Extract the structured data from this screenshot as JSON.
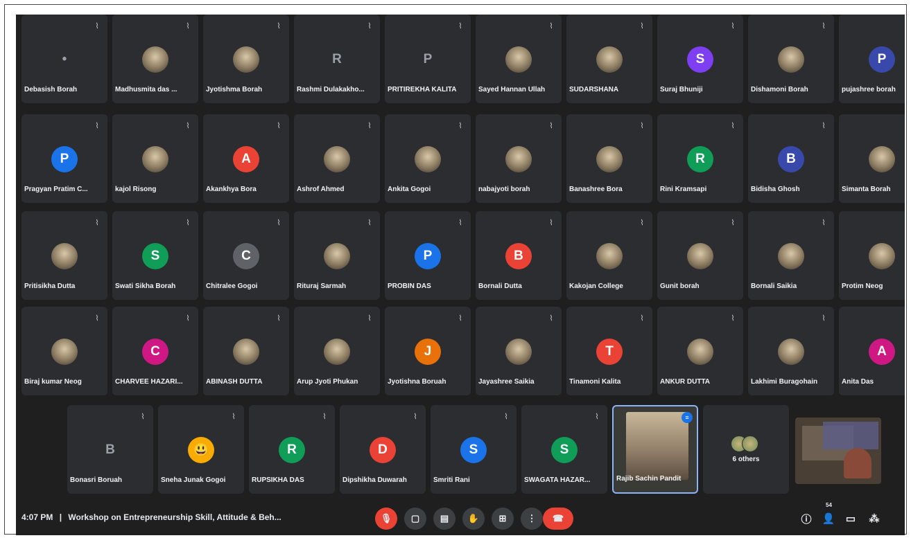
{
  "colors": {
    "blue": "#1a73e8",
    "teal": "#0f9d58",
    "gray": "#5f6368",
    "red": "#ea4335",
    "orange": "#e8710a",
    "pink": "#d01884",
    "dark": "#3c4043"
  },
  "rows": [
    [
      {
        "name": "Debasish Borah",
        "type": "plain",
        "letter": "•"
      },
      {
        "name": "Madhusmita das ...",
        "type": "photo"
      },
      {
        "name": "Jyotishma Borah",
        "type": "photo"
      },
      {
        "name": "Rashmi Dulakakho...",
        "type": "plain",
        "letter": "R"
      },
      {
        "name": "PRITIREKHA KALITA",
        "type": "plain",
        "letter": "P"
      },
      {
        "name": "Sayed Hannan Ullah",
        "type": "photo"
      },
      {
        "name": "SUDARSHANA",
        "type": "photo"
      },
      {
        "name": "Suraj Bhuniji",
        "type": "letter",
        "letter": "S",
        "color": "#7e3ff2"
      },
      {
        "name": "Dishamoni Borah",
        "type": "photo"
      },
      {
        "name": "pujashree borah",
        "type": "letter",
        "letter": "P",
        "color": "#3949ab"
      }
    ],
    [
      {
        "name": "Pragyan Pratim C...",
        "type": "letter",
        "letter": "P",
        "color": "#1a73e8"
      },
      {
        "name": "kajol Risong",
        "type": "photo"
      },
      {
        "name": "Akankhya Bora",
        "type": "letter",
        "letter": "A",
        "color": "#ea4335"
      },
      {
        "name": "Ashrof Ahmed",
        "type": "photo"
      },
      {
        "name": "Ankita Gogoi",
        "type": "photo"
      },
      {
        "name": "nabajyoti borah",
        "type": "photo"
      },
      {
        "name": "Banashree Bora",
        "type": "photo"
      },
      {
        "name": "Rini Kramsapi",
        "type": "letter",
        "letter": "R",
        "color": "#0f9d58"
      },
      {
        "name": "Bidisha Ghosh",
        "type": "letter",
        "letter": "B",
        "color": "#3949ab"
      },
      {
        "name": "Simanta Borah",
        "type": "photo"
      }
    ],
    [
      {
        "name": "Pritisikha Dutta",
        "type": "photo"
      },
      {
        "name": "Swati Sikha Borah",
        "type": "letter",
        "letter": "S",
        "color": "#0f9d58"
      },
      {
        "name": "Chitralee Gogoi",
        "type": "letter",
        "letter": "C",
        "color": "#5f6368"
      },
      {
        "name": "Rituraj Sarmah",
        "type": "photo"
      },
      {
        "name": "PROBIN DAS",
        "type": "letter",
        "letter": "P",
        "color": "#1a73e8"
      },
      {
        "name": "Bornali Dutta",
        "type": "letter",
        "letter": "B",
        "color": "#ea4335"
      },
      {
        "name": "Kakojan College",
        "type": "photo"
      },
      {
        "name": "Gunit borah",
        "type": "photo"
      },
      {
        "name": "Bornali Saikia",
        "type": "photo"
      },
      {
        "name": "Protim Neog",
        "type": "photo"
      }
    ],
    [
      {
        "name": "Biraj kumar Neog",
        "type": "photo"
      },
      {
        "name": "CHARVEE HAZARI...",
        "type": "letter",
        "letter": "C",
        "color": "#d01884"
      },
      {
        "name": "ABINASH DUTTA",
        "type": "photo"
      },
      {
        "name": "Arup Jyoti Phukan",
        "type": "photo"
      },
      {
        "name": "Jyotishna Boruah",
        "type": "letter",
        "letter": "J",
        "color": "#e8710a"
      },
      {
        "name": "Jayashree Saikia",
        "type": "photo"
      },
      {
        "name": "Tinamoni Kalita",
        "type": "letter",
        "letter": "T",
        "color": "#ea4335"
      },
      {
        "name": "ANKUR DUTTA",
        "type": "photo"
      },
      {
        "name": "Lakhimi Buragohain",
        "type": "photo"
      },
      {
        "name": "Anita Das",
        "type": "letter",
        "letter": "A",
        "color": "#d01884"
      }
    ],
    [
      {
        "name": "Bonasri Boruah",
        "type": "plain",
        "letter": "B"
      },
      {
        "name": "Sneha Junak Gogoi",
        "type": "letter",
        "letter": "😃",
        "color": "#f9ab00"
      },
      {
        "name": "RUPSIKHA DAS",
        "type": "letter",
        "letter": "R",
        "color": "#0f9d58"
      },
      {
        "name": "Dipshikha Duwarah",
        "type": "letter",
        "letter": "D",
        "color": "#ea4335"
      },
      {
        "name": "Smriti Rani",
        "type": "letter",
        "letter": "S",
        "color": "#1a73e8"
      },
      {
        "name": "SWAGATA HAZAR...",
        "type": "letter",
        "letter": "S",
        "color": "#0f9d58"
      }
    ]
  ],
  "active_speaker": {
    "name": "Rajib Sachin Pandit"
  },
  "others": {
    "label": "6 others"
  },
  "bottom_bar": {
    "time": "4:07 PM",
    "separator": "|",
    "title": "Workshop on Entrepreneurship Skill, Attitude & Beh...",
    "participant_count": "54",
    "controls": {
      "mic": "mic-off-icon",
      "camera": "camera-icon",
      "captions": "captions-icon",
      "hand": "raise-hand-icon",
      "present": "present-icon",
      "more": "more-icon",
      "hangup": "hangup-icon"
    }
  }
}
